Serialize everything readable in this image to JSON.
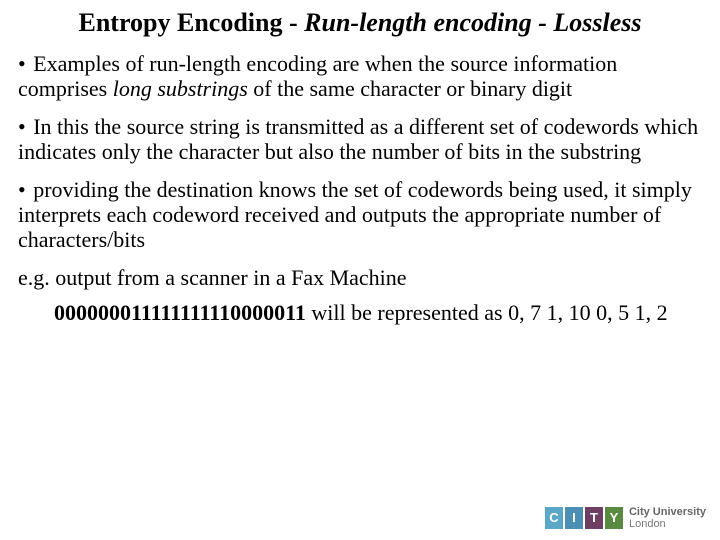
{
  "title": {
    "prefix": "Entropy Encoding",
    "dash1": " -  ",
    "italic": "Run-length encoding - Lossless"
  },
  "bullets": {
    "b1_pre": "Examples of run-length encoding are when the source information comprises ",
    "b1_italic": "long substrings",
    "b1_post": " of the same character or binary digit",
    "b2": "In this the source string is transmitted as a different set of codewords which indicates only the character but also the number of bits in the substring",
    "b3": "providing the destination knows the set of codewords being used, it simply interprets each codeword received and outputs the appropriate number of characters/bits"
  },
  "eg_label": "e.g. output from a scanner in a Fax Machine",
  "binary": "000000011111111110000011",
  "binary_post": " will be represented as 0, 7 1, 10 0, 5 1, 2",
  "logo": {
    "c": "C",
    "i": "I",
    "t": "T",
    "y": "Y",
    "line1": "City University",
    "line2": "London"
  }
}
